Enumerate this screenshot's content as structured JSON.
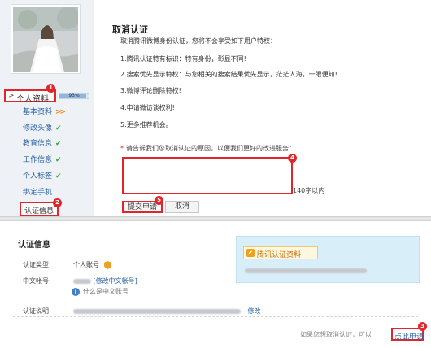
{
  "sidebar": {
    "profile_arrow": ">",
    "profile_label": "个人资料",
    "progress_percent": 93,
    "progress_label": "93%",
    "items": [
      {
        "label": "基本资料",
        "mark": ">>",
        "mark_type": "arrows"
      },
      {
        "label": "修改头像",
        "mark": "✔",
        "mark_type": "check"
      },
      {
        "label": "教育信息",
        "mark": "✔",
        "mark_type": "check"
      },
      {
        "label": "工作信息",
        "mark": "✔",
        "mark_type": "check"
      },
      {
        "label": "个人标签",
        "mark": "✔",
        "mark_type": "check"
      },
      {
        "label": "绑定手机",
        "mark": "",
        "mark_type": "none"
      }
    ],
    "cert_tab_label": "认证信息"
  },
  "cancel_form": {
    "title": "取消认证",
    "intro": "取消腾讯微博身份认证，您将不会享受如下用户特权：",
    "privileges": [
      "1.腾讯认证特有标识：特有身份，彰显不同!",
      "2.搜索优先显示特权：与您相关的搜索结果优先显示，茫茫人海，一眼便知!",
      "3.微博评论删除特权!",
      "4.申请微访谈权利!",
      "5.更多推荐机会。"
    ],
    "reason_star": "*",
    "reason_label": "请告诉我们您取消认证的原因，以便我们更好的改进服务：",
    "reason_value": "",
    "char_limit": "140字以内",
    "submit_label": "提交申请",
    "cancel_label": "取消"
  },
  "cert_info": {
    "title": "认证信息",
    "type_label": "认证类型:",
    "type_value": "个人账号",
    "cn_account_label": "中文帐号:",
    "cn_account_edit": "[修改中文帐号]",
    "cn_account_help": "什么是中文账号",
    "desc_label": "认证说明:",
    "desc_edit": "修改",
    "tencent_badge": "腾讯认证资料",
    "footer_text": "如果您想取消认证，可以",
    "apply_link": "点此申请"
  },
  "annotations": [
    "1",
    "2",
    "3",
    "4",
    "5"
  ],
  "colors": {
    "annotation_red": "#e0262b",
    "link_blue": "#2a64a6",
    "check_green": "#2eaa3a",
    "arrow_orange": "#f08a1c",
    "tencent_box_bg": "#d8eef8"
  },
  "icons": {
    "profile_arrow": "chevron-right-icon",
    "check": "check-icon",
    "shield": "shield-icon",
    "info": "info-icon",
    "tencent_badge": "tencent-cert-icon"
  }
}
